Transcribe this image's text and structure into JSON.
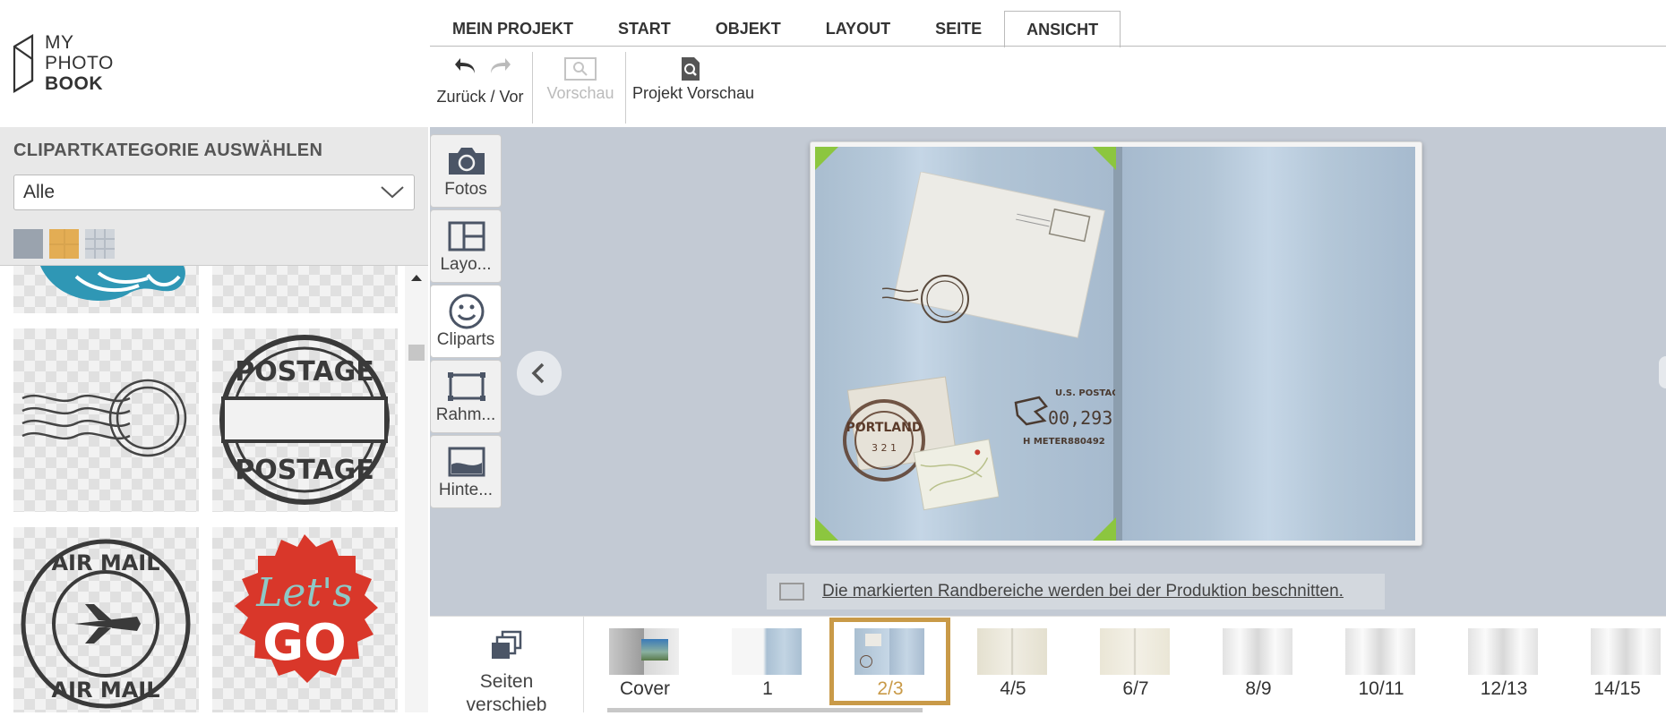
{
  "app": {
    "logo": {
      "line1": "MY",
      "line2": "PHOTO",
      "line3": "BOOK"
    }
  },
  "tabs": [
    {
      "label": "MEIN PROJEKT"
    },
    {
      "label": "START"
    },
    {
      "label": "OBJEKT"
    },
    {
      "label": "LAYOUT"
    },
    {
      "label": "SEITE"
    },
    {
      "label": "ANSICHT",
      "active": true
    }
  ],
  "toolbar": {
    "undo_redo_label": "Zurück / Vor",
    "preview_label": "Vorschau",
    "project_preview_label": "Projekt Vorschau"
  },
  "left_panel": {
    "title": "CLIPARTKATEGORIE AUSWÄHLEN",
    "category_value": "Alle",
    "clips": [
      {
        "name": "waves-clipart"
      },
      {
        "name": "empty-clipart"
      },
      {
        "name": "postmark-waves-clipart"
      },
      {
        "name": "postage-stamp-clipart",
        "text_top": "POSTAGE",
        "text_bottom": "POSTAGE"
      },
      {
        "name": "air-mail-clipart",
        "text_top": "AIR MAIL",
        "text_bottom": "AIR MAIL"
      },
      {
        "name": "lets-go-clipart",
        "text_top": "Let's",
        "text_bottom": "GO"
      }
    ]
  },
  "side_tools": [
    {
      "label": "Fotos",
      "icon": "camera-icon"
    },
    {
      "label": "Layo...",
      "icon": "layout-icon"
    },
    {
      "label": "Cliparts",
      "icon": "smiley-icon",
      "active": true
    },
    {
      "label": "Rahm...",
      "icon": "frame-icon"
    },
    {
      "label": "Hinte...",
      "icon": "background-icon"
    }
  ],
  "spread": {
    "stamp_text_1": "U.S. POSTAGE",
    "stamp_text_2": "00,293",
    "stamp_text_3": "H METER880492",
    "stamp_text_4": "PORTLAND",
    "stamp_text_5": "3 2 1"
  },
  "notice": {
    "text": "Die markierten Randbereiche werden bei der Produktion beschnitten."
  },
  "bottom": {
    "move_label_1": "Seiten",
    "move_label_2": "verschieb",
    "pages": [
      {
        "label": "Cover"
      },
      {
        "label": "1"
      },
      {
        "label": "2/3",
        "selected": true
      },
      {
        "label": "4/5"
      },
      {
        "label": "6/7"
      },
      {
        "label": "8/9"
      },
      {
        "label": "10/11"
      },
      {
        "label": "12/13"
      },
      {
        "label": "14/15"
      }
    ]
  },
  "colors": {
    "accent": "#c99a48",
    "crop_marker": "#8cc63f",
    "lets_go_red": "#d9372a",
    "teal_clip": "#2f97b5"
  }
}
